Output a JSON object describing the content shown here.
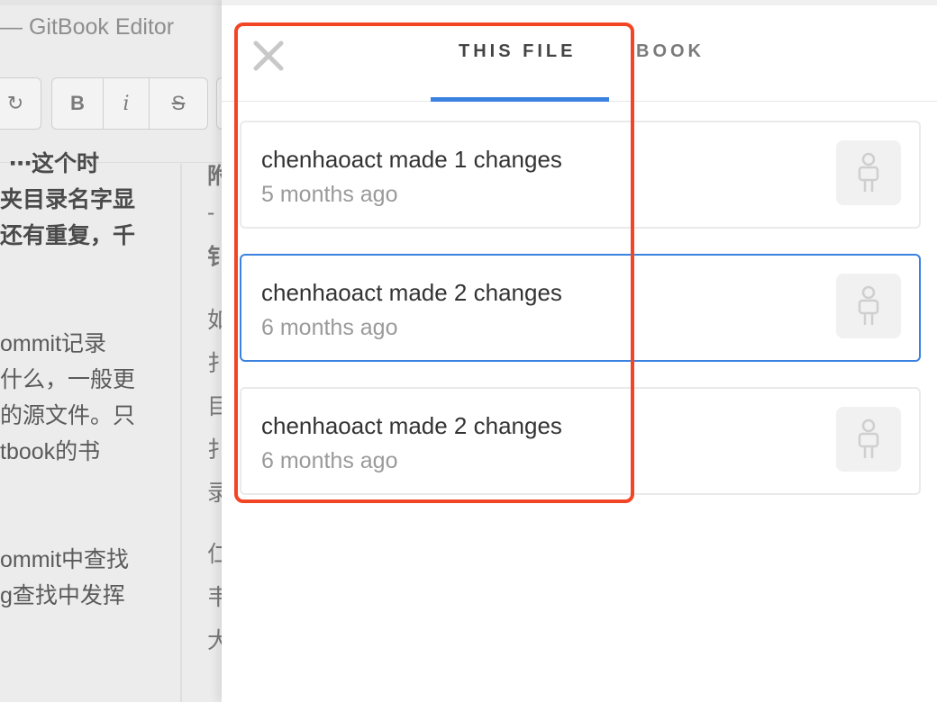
{
  "background": {
    "app_title": "— GitBook Editor",
    "toolbar": {
      "redo": "↻",
      "bold": "B",
      "italic": "i",
      "strike": "S"
    },
    "left_lines": [
      "⋯这个时",
      "夹目录名字显",
      "还有重复，千",
      "ommit记录",
      "什么，一般更",
      "的源文件。只",
      "tbook的书",
      "ommit中查找",
      "g查找中发挥"
    ],
    "right_lines": [
      "附",
      "-",
      "钅",
      "如",
      "扌",
      "目",
      "扌",
      "录",
      "仁",
      "韦",
      "大"
    ]
  },
  "panel": {
    "close_icon": "×",
    "tabs": [
      {
        "label": "THIS FILE",
        "active": true
      },
      {
        "label": "BOOK",
        "active": false
      }
    ],
    "accent_color": "#3b82e0",
    "history": [
      {
        "title": "chenhaoact made 1 changes",
        "time": "5 months ago",
        "selected": false
      },
      {
        "title": "chenhaoact made 2 changes",
        "time": "6 months ago",
        "selected": true
      },
      {
        "title": "chenhaoact made 2 changes",
        "time": "6 months ago",
        "selected": false
      }
    ],
    "annotation_color": "#f24526"
  }
}
